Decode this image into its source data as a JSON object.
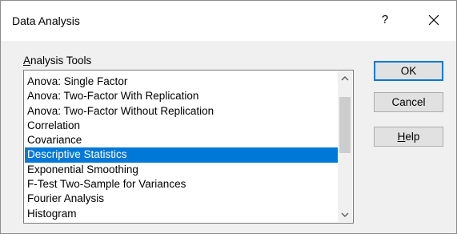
{
  "window": {
    "title": "Data Analysis",
    "help_glyph": "?",
    "close_glyph": "✕"
  },
  "group": {
    "label_accel": "A",
    "label_rest": "nalysis Tools"
  },
  "tools": [
    "Anova: Single Factor",
    "Anova: Two-Factor With Replication",
    "Anova: Two-Factor Without Replication",
    "Correlation",
    "Covariance",
    "Descriptive Statistics",
    "Exponential Smoothing",
    "F-Test Two-Sample for Variances",
    "Fourier Analysis",
    "Histogram"
  ],
  "selected_tool": "Descriptive Statistics",
  "buttons": {
    "ok": "OK",
    "cancel": "Cancel",
    "help_accel": "H",
    "help_rest": "elp"
  },
  "icons": {
    "scroll_up": "chevron-up-icon",
    "scroll_down": "chevron-down-icon",
    "close": "close-icon"
  },
  "colors": {
    "selection": "#0078d7",
    "default_button_border": "#0078d7",
    "dialog_background": "#f0f0f0"
  }
}
